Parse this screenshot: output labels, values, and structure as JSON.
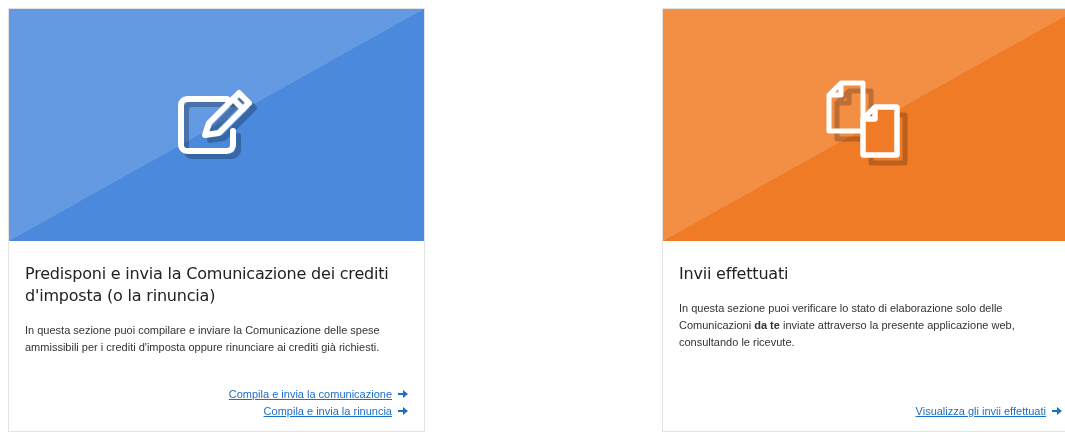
{
  "cards": [
    {
      "kind": "edit",
      "color": "#4a89dc",
      "title": "Predisponi e invia la Comunicazione dei crediti d'imposta (o la rinuncia)",
      "description": "In questa sezione puoi compilare e inviare la Comunicazione delle spese ammissibili per i crediti d'imposta oppure rinunciare ai crediti già richiesti.",
      "links": [
        "Compila e invia la comunicazione",
        "Compila e invia la rinuncia"
      ]
    },
    {
      "kind": "documents",
      "color": "#f07b26",
      "title": "Invii effettuati",
      "description": "In questa sezione puoi verificare lo stato di elaborazione solo delle Comunicazioni **da te** inviate attraverso la presente applicazione web, consultando le ricevute.",
      "links": [
        "Visualizza gli invii effettuati"
      ]
    }
  ]
}
